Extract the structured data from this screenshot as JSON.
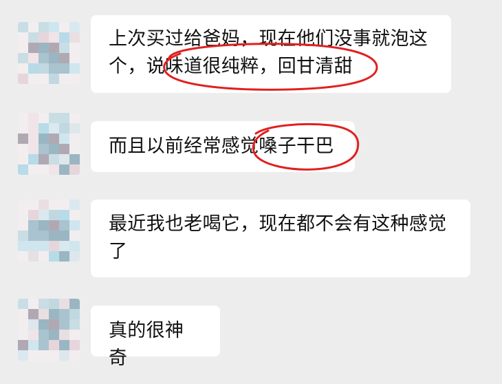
{
  "chat": {
    "messages": [
      {
        "text": "上次买过给爸妈，现在他们没事就泡这\n个，说味道很纯粹，回甘清甜"
      },
      {
        "text": "而且以前经常感觉嗓子干巴"
      },
      {
        "text": "最近我也老喝它，现在都不会有这种感觉\n了"
      },
      {
        "text": "真的很神奇"
      }
    ]
  },
  "avatar": {
    "palette": [
      "#cfe6ef",
      "#b7dbe8",
      "#e6d6dc",
      "#d9e9ef",
      "#a9c3cf",
      "#c9dde4",
      "#e9dfe3",
      "#9ab6c2",
      "#f0e4e8",
      "#c2d8e1",
      "#dde7ec",
      "#b0a9b3"
    ],
    "style": "pixelated-mosaic"
  },
  "annotations": {
    "color": "#e02020",
    "shape": "red-hand-drawn-ellipse"
  }
}
